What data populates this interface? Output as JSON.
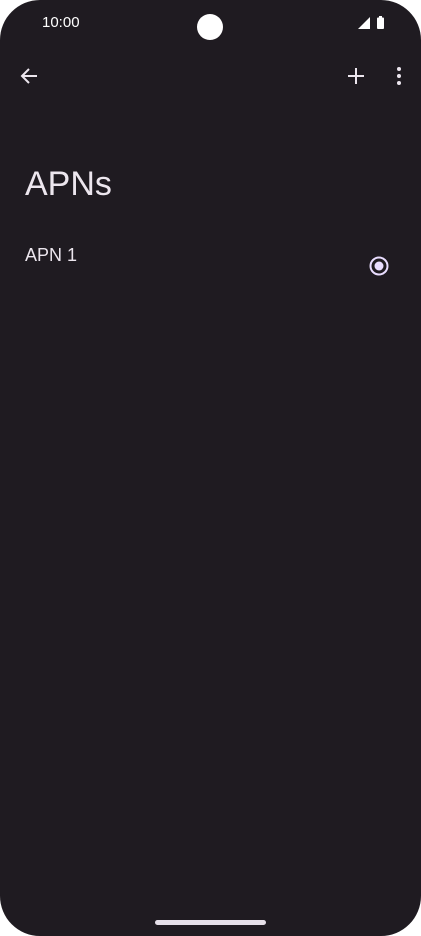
{
  "status_bar": {
    "time": "10:00",
    "icons": [
      "camera-cutout",
      "signal-icon",
      "battery-icon"
    ]
  },
  "toolbar": {
    "back_icon": "arrow-left-icon",
    "add_icon": "plus-icon",
    "more_icon": "more-vert-icon"
  },
  "page": {
    "title": "APNs"
  },
  "apn_list": [
    {
      "label": "APN 1",
      "selected": true
    }
  ],
  "colors": {
    "background": "#1f1b21",
    "text": "#ece6ee",
    "accent": "#e9ddff"
  }
}
